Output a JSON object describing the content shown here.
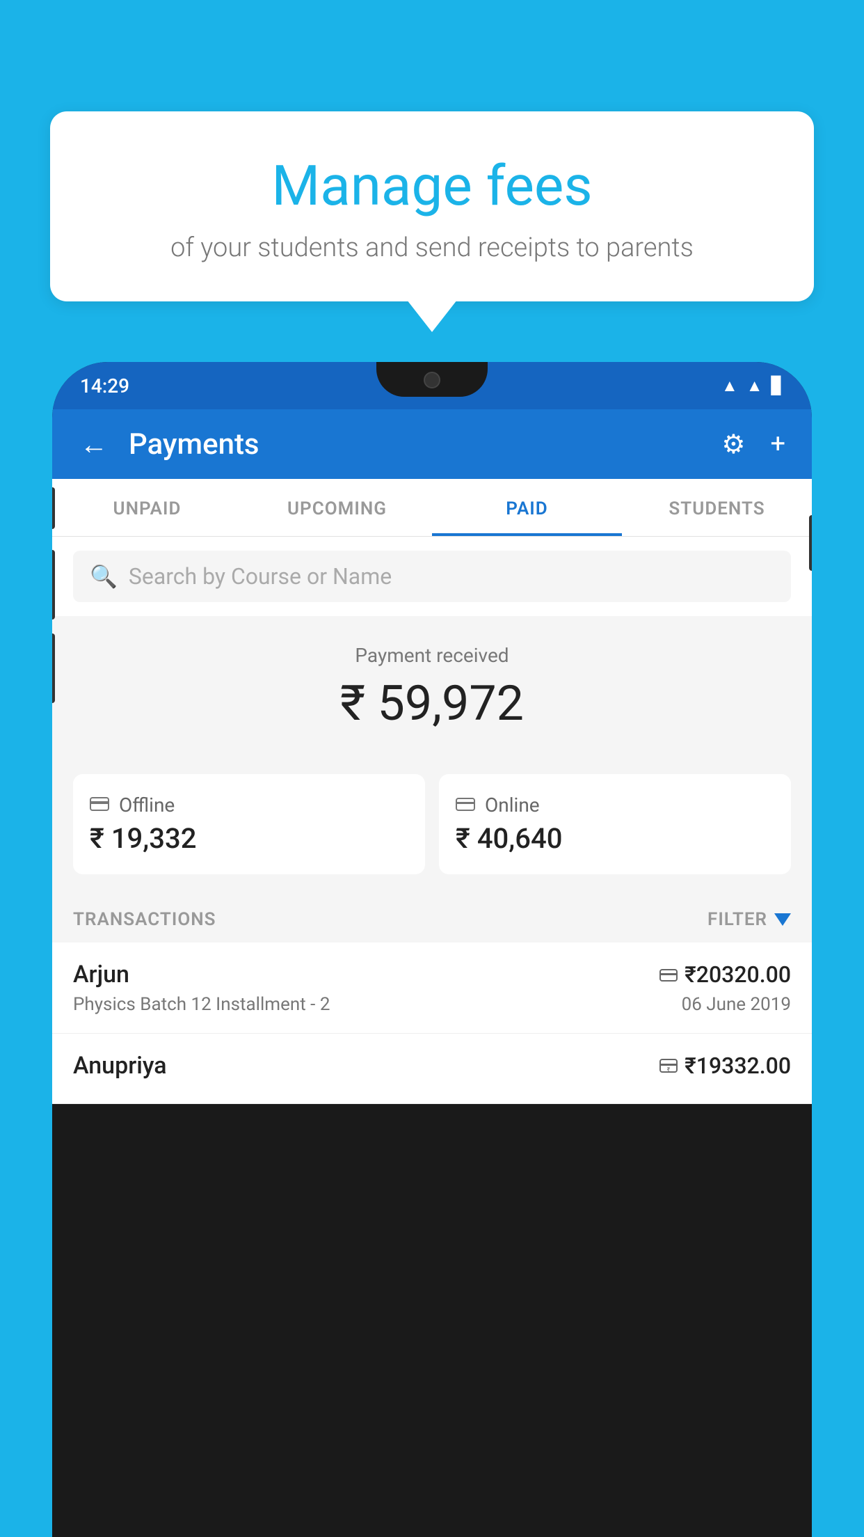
{
  "bubble": {
    "title": "Manage fees",
    "subtitle": "of your students and send receipts to parents"
  },
  "status_bar": {
    "time": "14:29"
  },
  "header": {
    "title": "Payments",
    "back_label": "←",
    "gear_label": "⚙",
    "plus_label": "+"
  },
  "tabs": [
    {
      "label": "UNPAID",
      "active": false
    },
    {
      "label": "UPCOMING",
      "active": false
    },
    {
      "label": "PAID",
      "active": true
    },
    {
      "label": "STUDENTS",
      "active": false
    }
  ],
  "search": {
    "placeholder": "Search by Course or Name"
  },
  "payment_received": {
    "label": "Payment received",
    "amount": "₹ 59,972"
  },
  "offline_card": {
    "icon": "💳",
    "label": "Offline",
    "amount": "₹ 19,332"
  },
  "online_card": {
    "icon": "💳",
    "label": "Online",
    "amount": "₹ 40,640"
  },
  "transactions_header": {
    "label": "TRANSACTIONS",
    "filter_label": "FILTER"
  },
  "transactions": [
    {
      "name": "Arjun",
      "course": "Physics Batch 12 Installment - 2",
      "amount": "₹20320.00",
      "date": "06 June 2019",
      "type": "online"
    },
    {
      "name": "Anupriya",
      "course": "",
      "amount": "₹19332.00",
      "date": "",
      "type": "offline"
    }
  ]
}
